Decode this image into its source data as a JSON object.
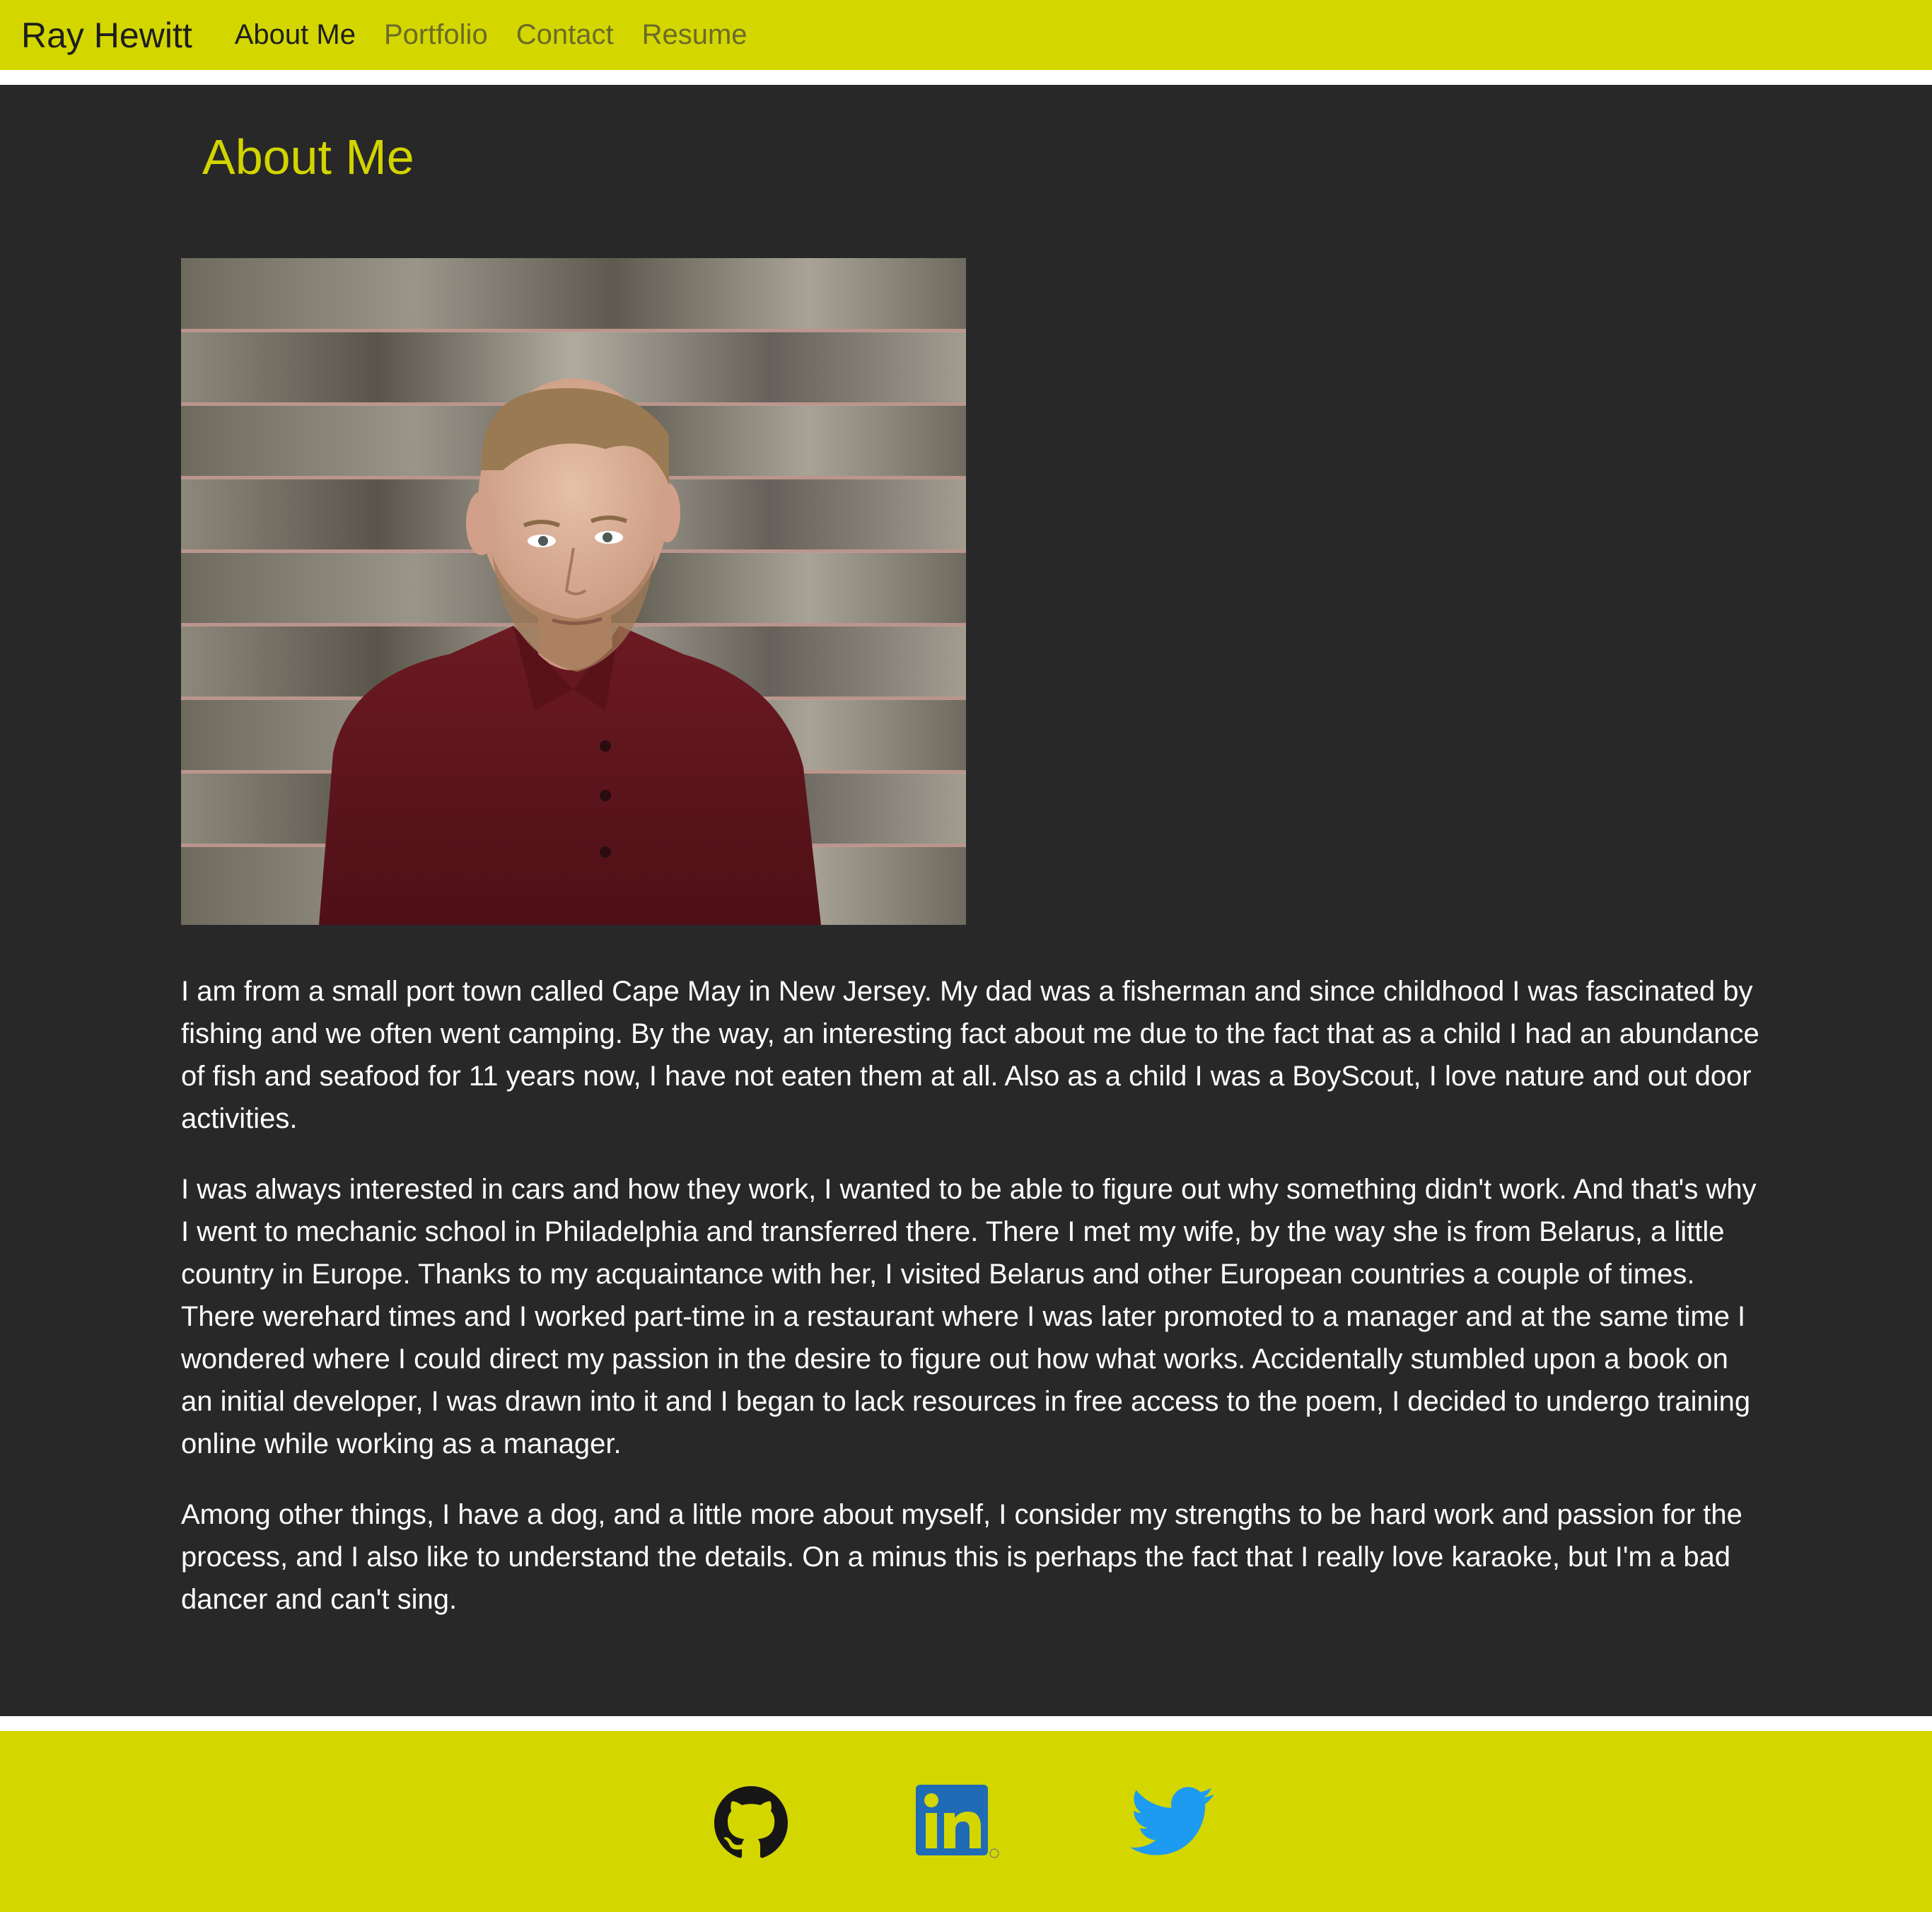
{
  "navbar": {
    "brand": "Ray Hewitt",
    "links": [
      {
        "label": "About Me"
      },
      {
        "label": "Portfolio"
      },
      {
        "label": "Contact"
      },
      {
        "label": "Resume"
      }
    ],
    "colors": {
      "background": "#d4d600",
      "active": "#1e1e1e",
      "inactive": "#6b6b28"
    }
  },
  "main": {
    "title": "About Me",
    "photo_icon": "portrait-photo",
    "paragraphs": [
      "I am from a small port town called Cape May in New Jersey. My dad was a fisherman and since childhood I was fascinated by fishing and we often went camping. By the way, an interesting fact about me due to the fact that as a child I had an abundance of fish and seafood for 11 years now, I have not eaten them at all. Also as a child I was a BoyScout, I love nature and out door activities.",
      "I was always interested in cars and how they work, I wanted to be able to figure out why something didn't work. And that's why I went to mechanic school in Philadelphia and transferred there. There I met my wife, by the way she is from Belarus, a little country in Europe. Thanks to my acquaintance with her, I visited Belarus and other European countries a couple of times. There werehard times and I worked part-time in a restaurant where I was later promoted to a manager and at the same time I wondered where I could direct my passion in the desire to figure out how what works. Accidentally stumbled upon a book on an initial developer, I was drawn into it and I began to lack resources in free access to the poem, I decided to undergo training online while working as a manager.",
      "Among other things, I have a dog, and a little more about myself, I consider my strengths to be hard work and passion for the process, and I also like to understand the details. On a minus this is perhaps the fact that I really love karaoke, but I'm a bad dancer and can't sing."
    ],
    "colors": {
      "background": "#282828",
      "title": "#d2d400",
      "text": "#ffffff"
    }
  },
  "footer": {
    "icons": [
      "github-icon",
      "linkedin-icon",
      "twitter-icon"
    ],
    "colors": {
      "background": "#d4d600",
      "linkedin": "#1f6bb5",
      "twitter": "#1d9bf0",
      "github": "#161616"
    }
  }
}
